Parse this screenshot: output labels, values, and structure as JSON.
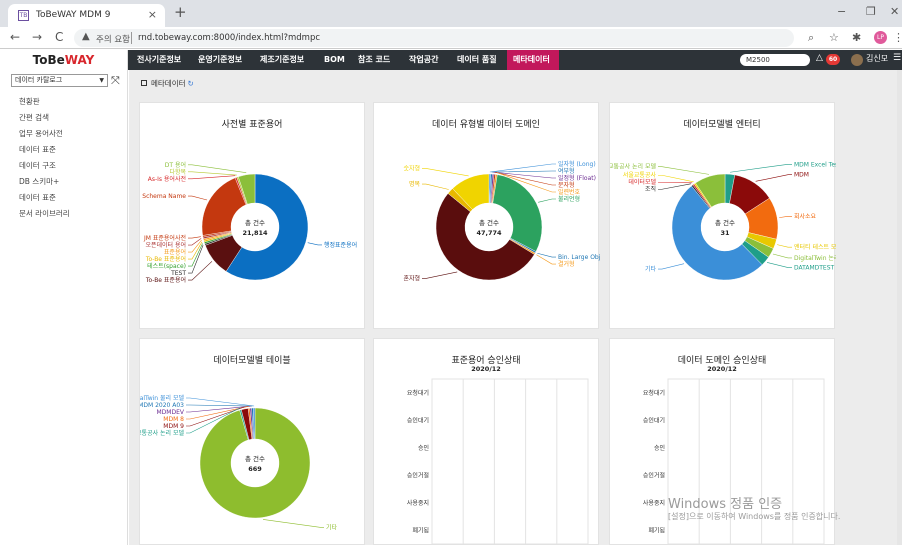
{
  "browser": {
    "tab_title": "ToBeWAY MDM 9",
    "favicon": "TB",
    "tab_close": "×",
    "new_tab": "+",
    "controls": [
      "−",
      "❐",
      "✕"
    ],
    "nav": [
      "←",
      "→",
      "C"
    ],
    "security_text": "주의 요함",
    "url": "rnd.tobeway.com:8000/index.html?mdmpc",
    "profile": "LP"
  },
  "app": {
    "logo_a": "ToBe",
    "logo_b": "WAY",
    "menu": [
      "전사기준정보",
      "운영기준정보",
      "제조기준정보",
      "BOM",
      "참조 코드",
      "작업공간",
      "데이터 품질",
      "메타데이터"
    ],
    "active_menu": "메타데이터",
    "search_value": "M2500",
    "notif_count": "60",
    "user_name": "김신모",
    "user_menu_icon": "hamburger-icon"
  },
  "sidebar": {
    "catalog": "데이터 카탈로그",
    "items": [
      "현황판",
      "간편 검색",
      "업무 용어사전",
      "데이터 표준",
      "데이터 구조",
      "DB 스키마+",
      "데이터 표준",
      "문서 라이브러리"
    ]
  },
  "breadcrumb": {
    "label": "메타데이터",
    "refresh_icon": "↻"
  },
  "colors": {
    "nav_bg": "#2d3338",
    "active": "#c2185b",
    "accent_red": "#d8262c"
  },
  "cards": {
    "c1": {
      "title": "사전별 표준용어",
      "center_label": "총 건수",
      "center_value": "21,814"
    },
    "c2": {
      "title": "데이터 유형별 데이터 도메인",
      "center_label": "총 건수",
      "center_value": "47,774"
    },
    "c3": {
      "title": "데이터모델별 엔터티",
      "center_label": "총 건수",
      "center_value": "31"
    },
    "c4": {
      "title": "데이터모델별 테이블",
      "center_label": "총 건수",
      "center_value": "669"
    },
    "c5": {
      "title": "표준용어 승인상태",
      "subtitle": "2020/12"
    },
    "c6": {
      "title": "데이터 도메인 승인상태",
      "subtitle": "2020/12"
    }
  },
  "chart_data": [
    {
      "type": "pie",
      "title": "사전별 표준용어",
      "slices": [
        {
          "label": "행정표준용어",
          "value": 0.58,
          "color": "#0b6fc2"
        },
        {
          "label": "To-Be 표준용어",
          "value": 0.1,
          "color": "#5a1010"
        },
        {
          "label": "TEST",
          "value": 0.005,
          "color": "#2d2d2d"
        },
        {
          "label": "테스트(space)",
          "value": 0.005,
          "color": "#33a02c"
        },
        {
          "label": "To-Be 표준용어",
          "value": 0.005,
          "color": "#e8b800"
        },
        {
          "label": "표준용어",
          "value": 0.005,
          "color": "#f59a1b"
        },
        {
          "label": "오픈데이터 용어",
          "value": 0.005,
          "color": "#a33"
        },
        {
          "label": "JM 표준용어사전",
          "value": 0.005,
          "color": "#c4380f"
        },
        {
          "label": "ul Schema Name",
          "value": 0.21,
          "color": "#c4380f"
        },
        {
          "label": "As-Is 용어사전",
          "value": 0.005,
          "color": "#d62728"
        },
        {
          "label": "다항목",
          "value": 0.005,
          "color": "#b6c933"
        },
        {
          "label": "DT 용어",
          "value": 0.05,
          "color": "#8bbf3a"
        }
      ]
    },
    {
      "type": "pie",
      "title": "데이터 유형별 데이터 도메인",
      "slices": [
        {
          "label": "일자형 (Long)",
          "value": 0.005,
          "color": "#3b8fd8"
        },
        {
          "label": "여부형",
          "value": 0.005,
          "color": "#1f77b4"
        },
        {
          "label": "일정형 (Float)",
          "value": 0.005,
          "color": "#6b2c91"
        },
        {
          "label": "문자형",
          "value": 0.005,
          "color": "#c4380f"
        },
        {
          "label": "일련번호",
          "value": 0.005,
          "color": "#f59a1b"
        },
        {
          "label": "불리언형",
          "value": 0.3,
          "color": "#2ca25f"
        },
        {
          "label": "Bin. Large Obj. (BLOB)",
          "value": 0.005,
          "color": "#1f77b4"
        },
        {
          "label": "결거형",
          "value": 0.005,
          "color": "#f59a1b"
        },
        {
          "label": "혼자형",
          "value": 0.52,
          "color": "#5a0d0d"
        },
        {
          "label": "명목",
          "value": 0.02,
          "color": "#e8b800"
        },
        {
          "label": "숫자형",
          "value": 0.12,
          "color": "#f0d400"
        }
      ]
    },
    {
      "type": "pie",
      "title": "데이터모델별 엔터티",
      "slices": [
        {
          "label": "MDM Excel Test",
          "value": 0.03,
          "color": "#1f9e89"
        },
        {
          "label": "MDM",
          "value": 0.13,
          "color": "#8b0a0a"
        },
        {
          "label": "회사소요",
          "value": 0.13,
          "color": "#f26b0f"
        },
        {
          "label": "엔터티 테스트 모델",
          "value": 0.03,
          "color": "#e8c800"
        },
        {
          "label": "DigitalTwin 논리 모델",
          "value": 0.03,
          "color": "#8bbf3a"
        },
        {
          "label": "DATAMDTEST",
          "value": 0.03,
          "color": "#1f9e89"
        },
        {
          "label": "기타",
          "value": 0.52,
          "color": "#3b8fd8"
        },
        {
          "label": "조직",
          "value": 0.005,
          "color": "#2d2d2d"
        },
        {
          "label": "데이터모델",
          "value": 0.005,
          "color": "#d62728"
        },
        {
          "label": "서울교통공사",
          "value": 0.005,
          "color": "#f0d400"
        },
        {
          "label": "서울교통공사 논리 모델",
          "value": 0.095,
          "color": "#8bbf3a"
        }
      ]
    },
    {
      "type": "pie",
      "title": "데이터모델별 테이블",
      "slices": [
        {
          "label": "기타",
          "value": 0.955,
          "color": "#8ebd2e"
        },
        {
          "label": "서울교통공사 논리 모델",
          "value": 0.005,
          "color": "#1f9e89"
        },
        {
          "label": "MDM 9",
          "value": 0.02,
          "color": "#8b0a0a"
        },
        {
          "label": "MDM 8",
          "value": 0.005,
          "color": "#f26b0f"
        },
        {
          "label": "MDMDEV",
          "value": 0.005,
          "color": "#6b2c91"
        },
        {
          "label": "MDM 2020 A03",
          "value": 0.005,
          "color": "#1f77b4"
        },
        {
          "label": "DigitalTwin 물리 모델",
          "value": 0.005,
          "color": "#3b8fd8"
        }
      ]
    },
    {
      "type": "bar",
      "title": "표준용어 승인상태",
      "subtitle": "2020/12",
      "categories": [
        "요청대기",
        "승인대기",
        "승인",
        "승인거절",
        "사용중지",
        "폐기됨"
      ],
      "values": [
        0,
        0,
        0,
        0,
        0,
        0
      ]
    },
    {
      "type": "bar",
      "title": "데이터 도메인 승인상태",
      "subtitle": "2020/12",
      "categories": [
        "요청대기",
        "승인대기",
        "승인",
        "승인거절",
        "사용중지",
        "폐기됨"
      ],
      "values": [
        0,
        0,
        0,
        0,
        0,
        0
      ]
    }
  ],
  "watermark": {
    "line1": "Windows 정품 인증",
    "line2": "[설정]으로 이동하여 Windows를 정품 인증합니다."
  }
}
